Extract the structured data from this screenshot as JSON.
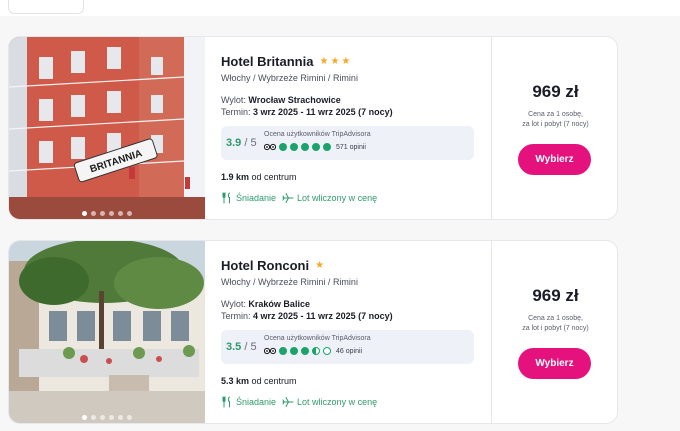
{
  "results": [
    {
      "name": "Hotel Britannia",
      "stars": 3,
      "location": "Włochy / Wybrzeże Rimini / Rimini",
      "departure_label": "Wylot: ",
      "departure": "Wrocław Strachowice",
      "term_label": "Termin: ",
      "term": "3 wrz 2025 - 11 wrz 2025 (7 nocy)",
      "rating": "3.9",
      "rating_den": " / 5",
      "ta_label": "Ocena użytkowników TripAdvisora",
      "ta_bubbles": [
        1,
        1,
        1,
        1,
        1
      ],
      "reviews": "571 opinii",
      "distance_value": "1.9 km",
      "distance_suffix": " od centrum",
      "amenity_meal": "Śniadanie",
      "amenity_flight": "Lot wliczony w cenę",
      "price": "969 zł",
      "price_note_1": "Cena za 1 osobę,",
      "price_note_2": "za lot i pobyt (7 nocy)",
      "cta": "Wybierz"
    },
    {
      "name": "Hotel Ronconi",
      "stars": 1,
      "location": "Włochy / Wybrzeże Rimini / Rimini",
      "departure_label": "Wylot: ",
      "departure": "Kraków Balice",
      "term_label": "Termin: ",
      "term": "4 wrz 2025 - 11 wrz 2025 (7 nocy)",
      "rating": "3.5",
      "rating_den": " / 5",
      "ta_label": "Ocena użytkowników TripAdvisora",
      "ta_bubbles": [
        1,
        1,
        1,
        0.5,
        0
      ],
      "reviews": "46 opinii",
      "distance_value": "5.3 km",
      "distance_suffix": " od centrum",
      "amenity_meal": "Śniadanie",
      "amenity_flight": "Lot wliczony w cenę",
      "price": "969 zł",
      "price_note_1": "Cena za 1 osobę,",
      "price_note_2": "za lot i pobyt (7 nocy)",
      "cta": "Wybierz"
    }
  ],
  "photo1_sign": "BRITANNIA",
  "colors": {
    "accent": "#e5127d",
    "rating_green": "#2f9a6b",
    "star": "#f4a92a"
  }
}
